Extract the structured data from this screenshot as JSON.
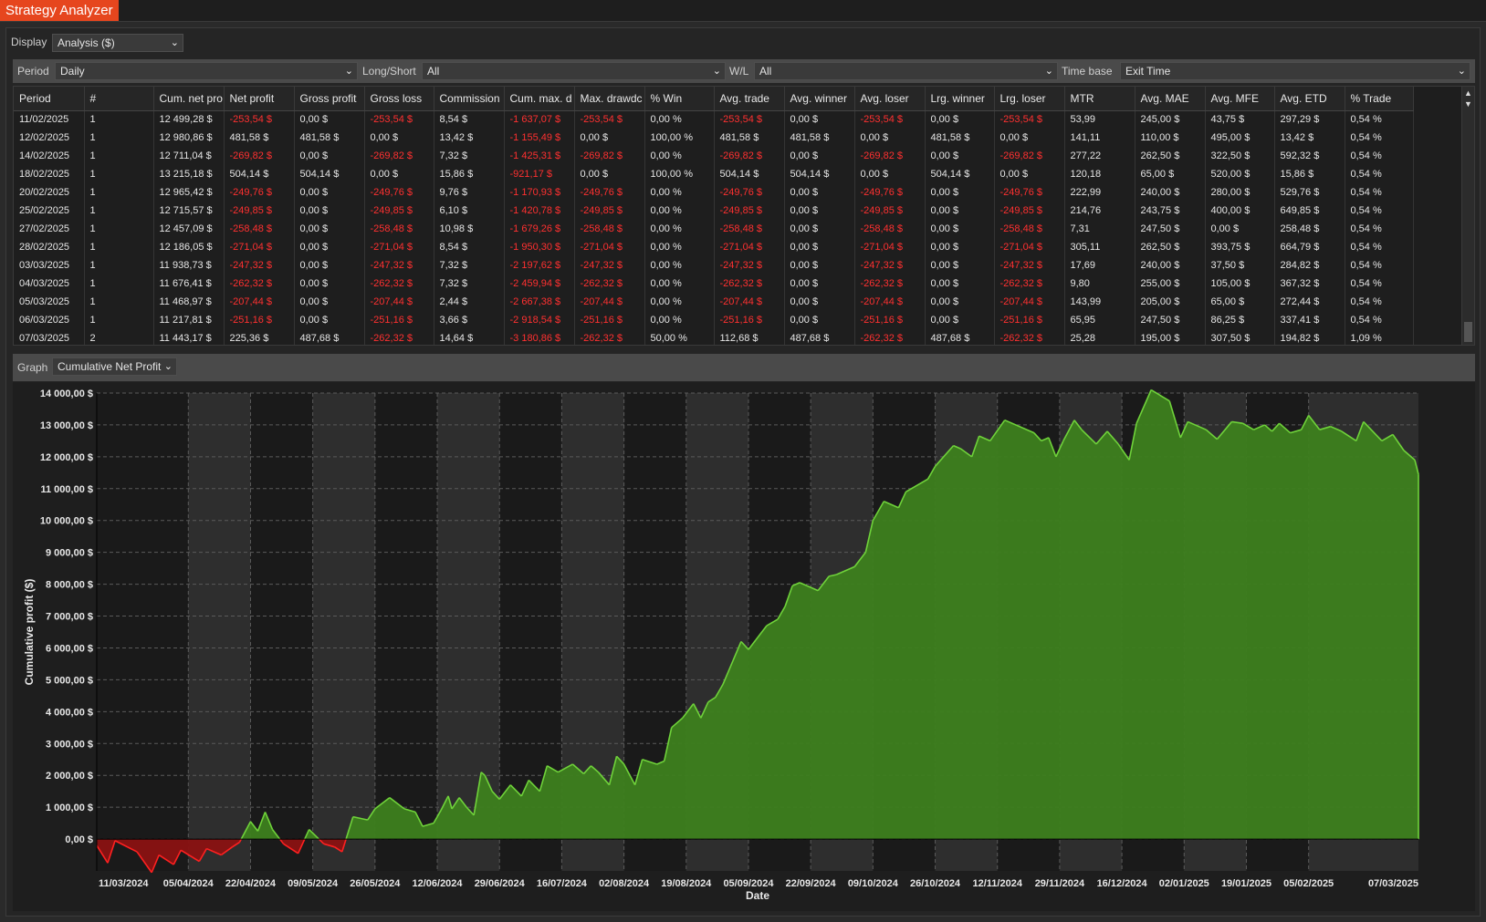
{
  "window": {
    "title": "Strategy Analyzer"
  },
  "display": {
    "label": "Display",
    "value": "Analysis ($)"
  },
  "filters": [
    {
      "label": "Period",
      "value": "Daily"
    },
    {
      "label": "Long/Short",
      "value": "All"
    },
    {
      "label": "W/L",
      "value": "All"
    },
    {
      "label": "Time base",
      "value": "Exit Time"
    }
  ],
  "table": {
    "columns": [
      "Period",
      "#",
      "Cum. net pro",
      "Net profit",
      "Gross profit",
      "Gross loss",
      "Commission",
      "Cum. max. d",
      "Max. drawdc",
      "% Win",
      "Avg. trade",
      "Avg. winner",
      "Avg. loser",
      "Lrg. winner",
      "Lrg. loser",
      "MTR",
      "Avg. MAE",
      "Avg. MFE",
      "Avg. ETD",
      "% Trade"
    ],
    "rows": [
      [
        "11/02/2025",
        "1",
        "12 499,28 $",
        "-253,54 $",
        "0,00 $",
        "-253,54 $",
        "8,54 $",
        "-1 637,07 $",
        "-253,54 $",
        "0,00 %",
        "-253,54 $",
        "0,00 $",
        "-253,54 $",
        "0,00 $",
        "-253,54 $",
        "53,99",
        "245,00 $",
        "43,75 $",
        "297,29 $",
        "0,54 %"
      ],
      [
        "12/02/2025",
        "1",
        "12 980,86 $",
        "481,58 $",
        "481,58 $",
        "0,00 $",
        "13,42 $",
        "-1 155,49 $",
        "0,00 $",
        "100,00 %",
        "481,58 $",
        "481,58 $",
        "0,00 $",
        "481,58 $",
        "0,00 $",
        "141,11",
        "110,00 $",
        "495,00 $",
        "13,42 $",
        "0,54 %"
      ],
      [
        "14/02/2025",
        "1",
        "12 711,04 $",
        "-269,82 $",
        "0,00 $",
        "-269,82 $",
        "7,32 $",
        "-1 425,31 $",
        "-269,82 $",
        "0,00 %",
        "-269,82 $",
        "0,00 $",
        "-269,82 $",
        "0,00 $",
        "-269,82 $",
        "277,22",
        "262,50 $",
        "322,50 $",
        "592,32 $",
        "0,54 %"
      ],
      [
        "18/02/2025",
        "1",
        "13 215,18 $",
        "504,14 $",
        "504,14 $",
        "0,00 $",
        "15,86 $",
        "-921,17 $",
        "0,00 $",
        "100,00 %",
        "504,14 $",
        "504,14 $",
        "0,00 $",
        "504,14 $",
        "0,00 $",
        "120,18",
        "65,00 $",
        "520,00 $",
        "15,86 $",
        "0,54 %"
      ],
      [
        "20/02/2025",
        "1",
        "12 965,42 $",
        "-249,76 $",
        "0,00 $",
        "-249,76 $",
        "9,76 $",
        "-1 170,93 $",
        "-249,76 $",
        "0,00 %",
        "-249,76 $",
        "0,00 $",
        "-249,76 $",
        "0,00 $",
        "-249,76 $",
        "222,99",
        "240,00 $",
        "280,00 $",
        "529,76 $",
        "0,54 %"
      ],
      [
        "25/02/2025",
        "1",
        "12 715,57 $",
        "-249,85 $",
        "0,00 $",
        "-249,85 $",
        "6,10 $",
        "-1 420,78 $",
        "-249,85 $",
        "0,00 %",
        "-249,85 $",
        "0,00 $",
        "-249,85 $",
        "0,00 $",
        "-249,85 $",
        "214,76",
        "243,75 $",
        "400,00 $",
        "649,85 $",
        "0,54 %"
      ],
      [
        "27/02/2025",
        "1",
        "12 457,09 $",
        "-258,48 $",
        "0,00 $",
        "-258,48 $",
        "10,98 $",
        "-1 679,26 $",
        "-258,48 $",
        "0,00 %",
        "-258,48 $",
        "0,00 $",
        "-258,48 $",
        "0,00 $",
        "-258,48 $",
        "7,31",
        "247,50 $",
        "0,00 $",
        "258,48 $",
        "0,54 %"
      ],
      [
        "28/02/2025",
        "1",
        "12 186,05 $",
        "-271,04 $",
        "0,00 $",
        "-271,04 $",
        "8,54 $",
        "-1 950,30 $",
        "-271,04 $",
        "0,00 %",
        "-271,04 $",
        "0,00 $",
        "-271,04 $",
        "0,00 $",
        "-271,04 $",
        "305,11",
        "262,50 $",
        "393,75 $",
        "664,79 $",
        "0,54 %"
      ],
      [
        "03/03/2025",
        "1",
        "11 938,73 $",
        "-247,32 $",
        "0,00 $",
        "-247,32 $",
        "7,32 $",
        "-2 197,62 $",
        "-247,32 $",
        "0,00 %",
        "-247,32 $",
        "0,00 $",
        "-247,32 $",
        "0,00 $",
        "-247,32 $",
        "17,69",
        "240,00 $",
        "37,50 $",
        "284,82 $",
        "0,54 %"
      ],
      [
        "04/03/2025",
        "1",
        "11 676,41 $",
        "-262,32 $",
        "0,00 $",
        "-262,32 $",
        "7,32 $",
        "-2 459,94 $",
        "-262,32 $",
        "0,00 %",
        "-262,32 $",
        "0,00 $",
        "-262,32 $",
        "0,00 $",
        "-262,32 $",
        "9,80",
        "255,00 $",
        "105,00 $",
        "367,32 $",
        "0,54 %"
      ],
      [
        "05/03/2025",
        "1",
        "11 468,97 $",
        "-207,44 $",
        "0,00 $",
        "-207,44 $",
        "2,44 $",
        "-2 667,38 $",
        "-207,44 $",
        "0,00 %",
        "-207,44 $",
        "0,00 $",
        "-207,44 $",
        "0,00 $",
        "-207,44 $",
        "143,99",
        "205,00 $",
        "65,00 $",
        "272,44 $",
        "0,54 %"
      ],
      [
        "06/03/2025",
        "1",
        "11 217,81 $",
        "-251,16 $",
        "0,00 $",
        "-251,16 $",
        "3,66 $",
        "-2 918,54 $",
        "-251,16 $",
        "0,00 %",
        "-251,16 $",
        "0,00 $",
        "-251,16 $",
        "0,00 $",
        "-251,16 $",
        "65,95",
        "247,50 $",
        "86,25 $",
        "337,41 $",
        "0,54 %"
      ],
      [
        "07/03/2025",
        "2",
        "11 443,17 $",
        "225,36 $",
        "487,68 $",
        "-262,32 $",
        "14,64 $",
        "-3 180,86 $",
        "-262,32 $",
        "50,00 %",
        "112,68 $",
        "487,68 $",
        "-262,32 $",
        "487,68 $",
        "-262,32 $",
        "25,28",
        "195,00 $",
        "307,50 $",
        "194,82 $",
        "1,09 %"
      ]
    ]
  },
  "graph": {
    "label": "Graph",
    "value": "Cumulative Net Profit"
  },
  "colors": {
    "accent": "#e6461e",
    "profit_fill": "#3d7f1e",
    "profit_line": "#6fd23a",
    "loss_fill": "#8a1212",
    "loss_line": "#ff2020",
    "negative_text": "#ff3030"
  },
  "chart_data": {
    "type": "area",
    "ylabel": "Cumulative profit ($)",
    "xlabel": "Date",
    "ylim": [
      -1000,
      14000
    ],
    "y_ticks": [
      "0,00 $",
      "1 000,00 $",
      "2 000,00 $",
      "3 000,00 $",
      "4 000,00 $",
      "5 000,00 $",
      "6 000,00 $",
      "7 000,00 $",
      "8 000,00 $",
      "9 000,00 $",
      "10 000,00 $",
      "11 000,00 $",
      "12 000,00 $",
      "13 000,00 $",
      "14 000,00 $"
    ],
    "x_tick_labels": [
      "11/03/2024",
      "05/04/2024",
      "22/04/2024",
      "09/05/2024",
      "26/05/2024",
      "12/06/2024",
      "29/06/2024",
      "16/07/2024",
      "02/08/2024",
      "19/08/2024",
      "05/09/2024",
      "22/09/2024",
      "09/10/2024",
      "26/10/2024",
      "12/11/2024",
      "29/11/2024",
      "16/12/2024",
      "02/01/2025",
      "19/01/2025",
      "05/02/2025",
      "07/03/2025"
    ],
    "x_range": [
      "2024-03-11",
      "2025-03-07"
    ],
    "grid": true,
    "series": [
      {
        "x": [
          "2024-03-11",
          "2024-03-14",
          "2024-03-16",
          "2024-03-22",
          "2024-03-26",
          "2024-03-28",
          "2024-04-01",
          "2024-04-03",
          "2024-04-08",
          "2024-04-10",
          "2024-04-14",
          "2024-04-17",
          "2024-04-19",
          "2024-04-22",
          "2024-04-24",
          "2024-04-26",
          "2024-04-28",
          "2024-05-01",
          "2024-05-05",
          "2024-05-08",
          "2024-05-12",
          "2024-05-15",
          "2024-05-17",
          "2024-05-20",
          "2024-05-24",
          "2024-05-26",
          "2024-05-30",
          "2024-06-03",
          "2024-06-06",
          "2024-06-08",
          "2024-06-11",
          "2024-06-13",
          "2024-06-15",
          "2024-06-16",
          "2024-06-18",
          "2024-06-20",
          "2024-06-22",
          "2024-06-24",
          "2024-06-25",
          "2024-06-27",
          "2024-06-29",
          "2024-07-02",
          "2024-07-05",
          "2024-07-07",
          "2024-07-10",
          "2024-07-12",
          "2024-07-15",
          "2024-07-19",
          "2024-07-22",
          "2024-07-24",
          "2024-07-26",
          "2024-07-29",
          "2024-07-31",
          "2024-08-02",
          "2024-08-05",
          "2024-08-07",
          "2024-08-11",
          "2024-08-13",
          "2024-08-15",
          "2024-08-18",
          "2024-08-21",
          "2024-08-23",
          "2024-08-25",
          "2024-08-27",
          "2024-08-29",
          "2024-09-03",
          "2024-09-05",
          "2024-09-07",
          "2024-09-10",
          "2024-09-13",
          "2024-09-15",
          "2024-09-17",
          "2024-09-19",
          "2024-09-24",
          "2024-09-27",
          "2024-09-29",
          "2024-10-04",
          "2024-10-07",
          "2024-10-09",
          "2024-10-12",
          "2024-10-16",
          "2024-10-18",
          "2024-10-24",
          "2024-10-26",
          "2024-10-31",
          "2024-11-02",
          "2024-11-05",
          "2024-11-07",
          "2024-11-10",
          "2024-11-14",
          "2024-11-22",
          "2024-11-24",
          "2024-11-26",
          "2024-11-28",
          "2024-11-30",
          "2024-12-03",
          "2024-12-05",
          "2024-12-09",
          "2024-12-12",
          "2024-12-15",
          "2024-12-18",
          "2024-12-20",
          "2024-12-24",
          "2024-12-29",
          "2025-01-01",
          "2025-01-03",
          "2025-01-08",
          "2025-01-11",
          "2025-01-15",
          "2025-01-18",
          "2025-01-21",
          "2025-01-24",
          "2025-01-26",
          "2025-01-28",
          "2025-01-31",
          "2025-02-03",
          "2025-02-05",
          "2025-02-08",
          "2025-02-11",
          "2025-02-14",
          "2025-02-18",
          "2025-02-20",
          "2025-02-25",
          "2025-02-28",
          "2025-03-03",
          "2025-03-06",
          "2025-03-07"
        ],
        "y": [
          -200,
          -750,
          -50,
          -400,
          -1050,
          -500,
          -800,
          -350,
          -700,
          -300,
          -500,
          -250,
          -100,
          550,
          250,
          850,
          300,
          -150,
          -450,
          300,
          -150,
          -250,
          -400,
          700,
          600,
          950,
          1300,
          950,
          850,
          400,
          500,
          900,
          1350,
          950,
          1300,
          1000,
          750,
          2100,
          2000,
          1500,
          1250,
          1700,
          1350,
          1850,
          1500,
          2300,
          2100,
          2350,
          2050,
          2300,
          2100,
          1700,
          2600,
          2350,
          1700,
          2500,
          2350,
          2450,
          3500,
          3800,
          4250,
          3800,
          4300,
          4450,
          4850,
          6200,
          5950,
          6250,
          6700,
          6900,
          7300,
          7950,
          8050,
          7800,
          8250,
          8300,
          8550,
          9000,
          10000,
          10600,
          10400,
          10900,
          11300,
          11700,
          12350,
          12250,
          12000,
          12650,
          12500,
          13150,
          12750,
          12500,
          12600,
          12000,
          12500,
          13150,
          12850,
          12400,
          12800,
          12400,
          11900,
          13050,
          14100,
          13750,
          12600,
          13100,
          12850,
          12550,
          13100,
          13050,
          12850,
          13000,
          12800,
          13050,
          12750,
          12850,
          13300,
          12850,
          12950,
          12800,
          12500,
          13100,
          12500,
          12700,
          12200,
          11900,
          11450
        ]
      }
    ]
  }
}
